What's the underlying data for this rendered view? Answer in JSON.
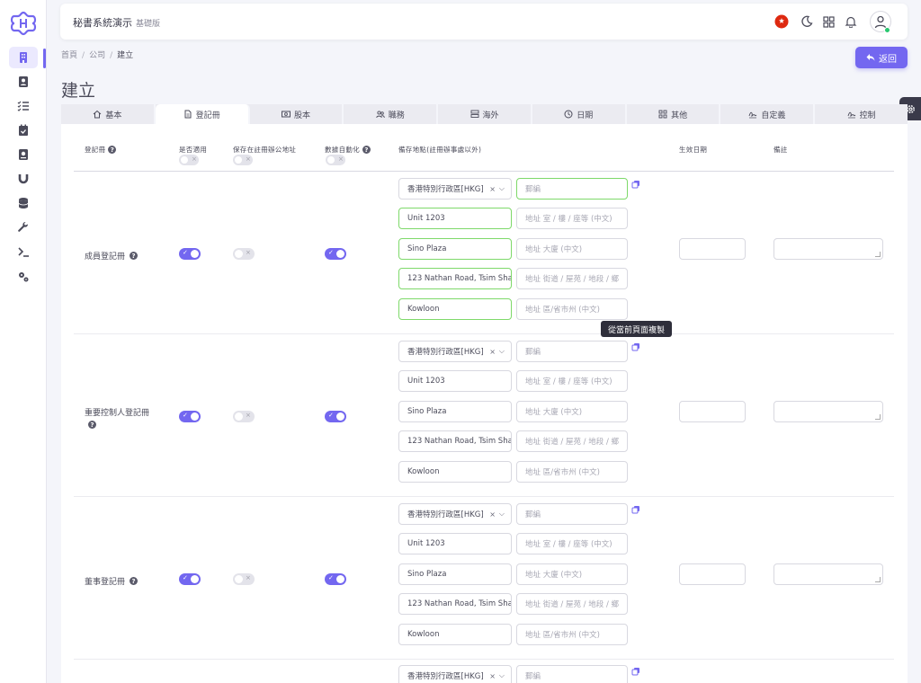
{
  "app": {
    "title": "秘書系統演示",
    "edition": "基礎版"
  },
  "breadcrumb": {
    "home": "首頁",
    "company": "公司",
    "current": "建立",
    "sep": "/"
  },
  "page": {
    "title": "建立",
    "back_label": "返回"
  },
  "tabs": [
    {
      "label": "基本",
      "icon": "home-icon"
    },
    {
      "label": "登記冊",
      "icon": "document-icon",
      "active": true
    },
    {
      "label": "股本",
      "icon": "money-icon"
    },
    {
      "label": "職務",
      "icon": "users-icon"
    },
    {
      "label": "海外",
      "icon": "server-icon"
    },
    {
      "label": "日期",
      "icon": "clock-icon"
    },
    {
      "label": "其他",
      "icon": "grid-icon"
    },
    {
      "label": "自定義",
      "icon": "signature-icon"
    },
    {
      "label": "控制",
      "icon": "signature-icon"
    }
  ],
  "columns": {
    "register": "登記冊",
    "applicable": "是否適用",
    "keep_at_office": "保存在註冊辦公地址",
    "data_auto": "數據自動化",
    "location": "備存地點(註冊辦事處以外)",
    "effective_date": "生效日期",
    "remarks": "備註"
  },
  "tooltip": "從當前頁面複製",
  "placeholders": {
    "postcode": "郵編",
    "room": "地址 室 / 樓 / 座等 (中文)",
    "building": "地址 大廈 (中文)",
    "street": "地址 街道 / 屋苑 / 地段 / 鄉",
    "district": "地址 區/省市州 (中文)"
  },
  "rows": [
    {
      "label": "成員登記冊",
      "help": true,
      "applicable": true,
      "keep_at_office": false,
      "data_auto": true,
      "region": "香港特別行政區[HKG]",
      "room": "Unit 1203",
      "building": "Sino Plaza",
      "street": "123 Nathan Road, Tsim Sha",
      "district": "Kowloon"
    },
    {
      "label": "重要控制人登記冊",
      "help": true,
      "applicable": true,
      "keep_at_office": false,
      "data_auto": true,
      "region": "香港特別行政區[HKG]",
      "room": "Unit 1203",
      "building": "Sino Plaza",
      "street": "123 Nathan Road, Tsim Sha",
      "district": "Kowloon"
    },
    {
      "label": "董事登記冊",
      "help": true,
      "applicable": true,
      "keep_at_office": false,
      "data_auto": true,
      "region": "香港特別行政區[HKG]",
      "room": "Unit 1203",
      "building": "Sino Plaza",
      "street": "123 Nathan Road, Tsim Sha",
      "district": "Kowloon"
    },
    {
      "label": "",
      "region": "香港特別行政區[HKG]"
    }
  ],
  "colors": {
    "accent": "#7367f0",
    "valid_border": "#7ed96a"
  }
}
